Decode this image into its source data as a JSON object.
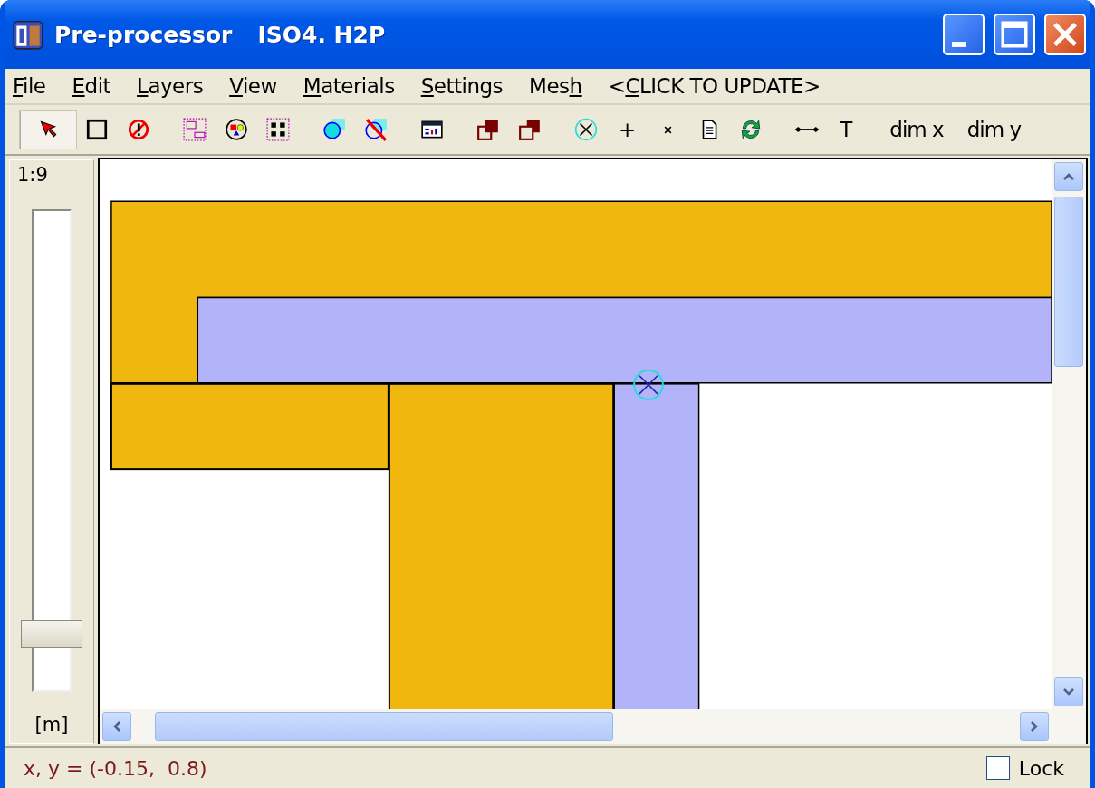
{
  "window": {
    "title": "Pre-processor",
    "file": "ISO4. H2P"
  },
  "menu": [
    {
      "key": "F",
      "after": "ile"
    },
    {
      "key": "E",
      "after": "dit"
    },
    {
      "key": "L",
      "after": "ayers"
    },
    {
      "key": "V",
      "after": "iew"
    },
    {
      "key": "M",
      "after": "aterials"
    },
    {
      "key": "S",
      "after": "ettings"
    },
    {
      "before": "Mes",
      "key": "h"
    },
    {
      "before": "<",
      "key": "C",
      "after": "LICK TO UPDATE>"
    }
  ],
  "toolbar": [
    [
      {
        "kind": "icon",
        "selected": true
      },
      {
        "kind": "icon",
        "selected": false
      },
      {
        "kind": "icon",
        "selected": false
      }
    ],
    [
      {
        "kind": "icon",
        "selected": false
      },
      {
        "kind": "icon",
        "selected": false
      },
      {
        "kind": "icon",
        "selected": false
      }
    ],
    [
      {
        "kind": "icon",
        "selected": false
      },
      {
        "kind": "icon",
        "selected": false
      }
    ],
    [
      {
        "kind": "icon",
        "selected": false
      }
    ],
    [
      {
        "kind": "icon",
        "selected": false
      },
      {
        "kind": "icon",
        "selected": false
      }
    ],
    [
      {
        "kind": "icon",
        "selected": false
      },
      {
        "kind": "text",
        "label": "+"
      },
      {
        "kind": "icon",
        "selected": false
      },
      {
        "kind": "icon",
        "selected": false
      },
      {
        "kind": "icon",
        "selected": false
      }
    ],
    [
      {
        "kind": "icon",
        "selected": false
      },
      {
        "kind": "text",
        "label": "T"
      }
    ],
    [
      {
        "kind": "text",
        "label": "dim x"
      },
      {
        "kind": "text",
        "label": "dim y"
      }
    ]
  ],
  "zoom": {
    "label": "1:9",
    "level": 0.12,
    "unit": "[m]"
  },
  "status_bar": {
    "coordinates": "x, y = (-0.15,  0.8)",
    "lock": {
      "label": "Lock",
      "checked": false
    }
  }
}
